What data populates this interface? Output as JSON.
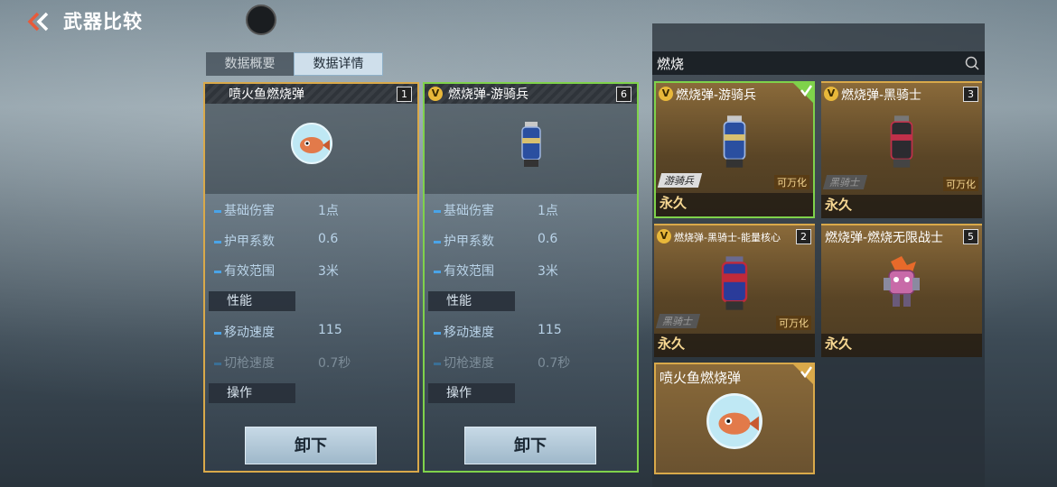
{
  "header": {
    "title": "武器比较",
    "back_icon": "chevron-double-left-icon"
  },
  "tabs": [
    {
      "label": "数据概要",
      "active": false
    },
    {
      "label": "数据详情",
      "active": true
    }
  ],
  "compare": [
    {
      "name": "喷火鱼燃烧弹",
      "level": "1",
      "border_color": "#d9a94a",
      "stats": [
        {
          "label": "基础伤害",
          "value": "1点"
        },
        {
          "label": "护甲系数",
          "value": "0.6"
        },
        {
          "label": "有效范围",
          "value": "3米"
        }
      ],
      "section_perf": "性能",
      "perf": [
        {
          "label": "移动速度",
          "value": "115"
        },
        {
          "label": "切枪速度",
          "value": "0.7秒"
        }
      ],
      "section_ops": "操作",
      "unload_label": "卸下"
    },
    {
      "name": "燃烧弹-游骑兵",
      "level": "6",
      "border_color": "#7fd24b",
      "stats": [
        {
          "label": "基础伤害",
          "value": "1点"
        },
        {
          "label": "护甲系数",
          "value": "0.6"
        },
        {
          "label": "有效范围",
          "value": "3米"
        }
      ],
      "section_perf": "性能",
      "perf": [
        {
          "label": "移动速度",
          "value": "115"
        },
        {
          "label": "切枪速度",
          "value": "0.7秒"
        }
      ],
      "section_ops": "操作",
      "unload_label": "卸下"
    }
  ],
  "search": {
    "value": "燃烧",
    "icon": "search-icon"
  },
  "inventory": [
    {
      "name": "燃烧弹-游骑兵",
      "tag": "游骑兵",
      "transform": "可万化",
      "duration": "永久",
      "selected": true
    },
    {
      "name": "燃烧弹-黑骑士",
      "level": "3",
      "tag": "黑骑士",
      "transform": "可万化",
      "duration": "永久"
    },
    {
      "name": "燃烧弹-黑骑士-能量核心",
      "level": "2",
      "tag": "黑骑士",
      "transform": "可万化",
      "duration": "永久"
    },
    {
      "name": "燃烧弹-燃烧无限战士",
      "level": "5",
      "duration": "永久"
    },
    {
      "name": "喷火鱼燃烧弹",
      "selected": true
    }
  ],
  "colors": {
    "selected_green": "#7fd24b",
    "gold": "#d9a94a",
    "stat_blue": "#4aa4e8"
  }
}
